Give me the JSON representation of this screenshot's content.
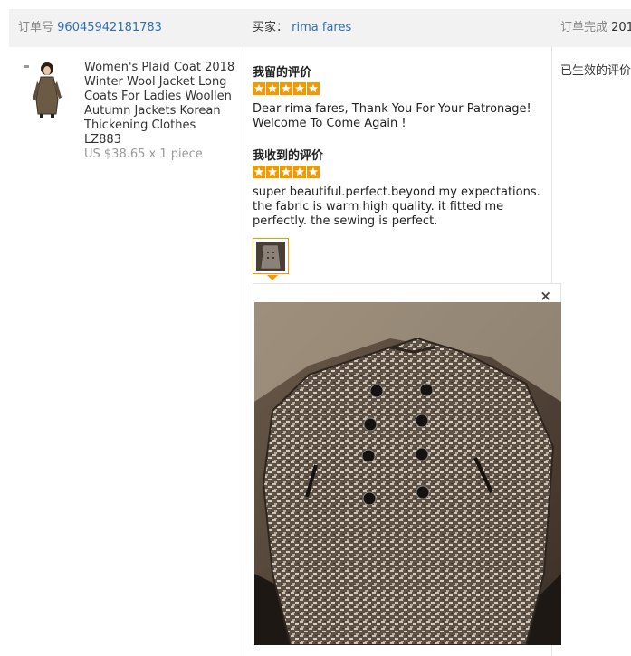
{
  "header": {
    "order_no_label": "订单号",
    "order_no": "96045942181783",
    "buyer_label": "买家：",
    "buyer_name": "rima fares",
    "status_label": "订单完成",
    "status_value": "201"
  },
  "product": {
    "title": "Women's Plaid Coat 2018 Winter Wool Jacket Long Coats For Ladies Woollen Autumn Jackets Korean Thickening Clothes LZ883",
    "price": "US $38.65 x 1 piece"
  },
  "my_review": {
    "title": "我留的评价",
    "rating": 5,
    "text": "Dear rima fares, Thank You For Your Patronage! Welcome To Come Again !"
  },
  "received_review": {
    "title": "我收到的评价",
    "rating": 5,
    "text": "super beautiful.perfect.beyond my expectations. the fabric is warm high quality. it fitted me perfectly. the sewing is perfect."
  },
  "review_status": "已生效的评价",
  "viewer": {
    "close_label": "×"
  },
  "icons": {
    "star": "star-icon",
    "close": "close-icon"
  },
  "colors": {
    "star": "#f39800",
    "link": "#2f6fb6",
    "header_bg": "#f2f2f2",
    "thumb_border": "#f39800"
  }
}
